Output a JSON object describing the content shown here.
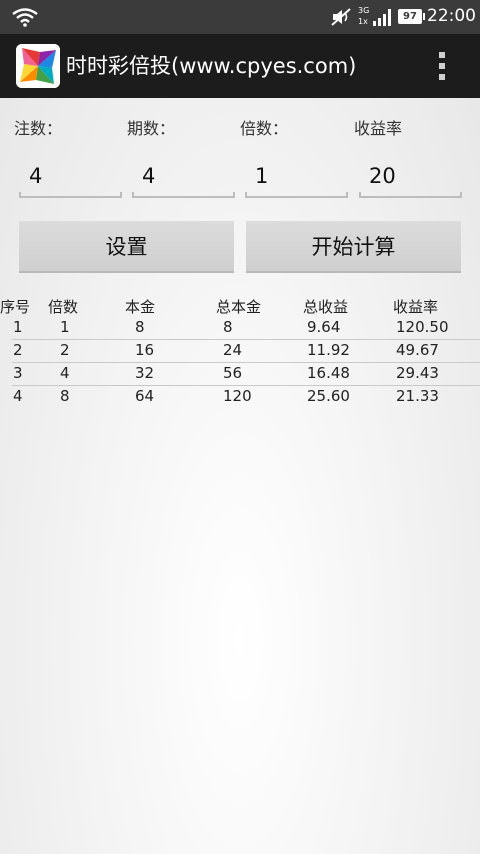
{
  "status_bar": {
    "network_top": "3G",
    "network_bottom": "1x",
    "battery": "97",
    "time": "22:00",
    "icons": [
      "wifi-icon",
      "mute-icon",
      "signal-icon",
      "battery-icon"
    ]
  },
  "app": {
    "title": "时时彩倍投(www.cpyes.com)",
    "icons": [
      "app-logo-icon",
      "overflow-menu-icon"
    ]
  },
  "inputs": {
    "labels": {
      "bets": "注数：",
      "periods": "期数：",
      "multiple": "倍数：",
      "yield": "收益率"
    },
    "values": {
      "bets": "4",
      "periods": "4",
      "multiple": "1",
      "yield": "20"
    }
  },
  "buttons": {
    "settings": "设置",
    "calculate": "开始计算"
  },
  "table": {
    "headers": [
      "序号",
      "倍数",
      "本金",
      "总本金",
      "总收益",
      "收益率"
    ],
    "rows": [
      [
        "1",
        "1",
        "8",
        "8",
        "9.64",
        "120.50"
      ],
      [
        "2",
        "2",
        "16",
        "24",
        "11.92",
        "49.67"
      ],
      [
        "3",
        "4",
        "32",
        "56",
        "16.48",
        "29.43"
      ],
      [
        "4",
        "8",
        "64",
        "120",
        "25.60",
        "21.33"
      ]
    ]
  }
}
